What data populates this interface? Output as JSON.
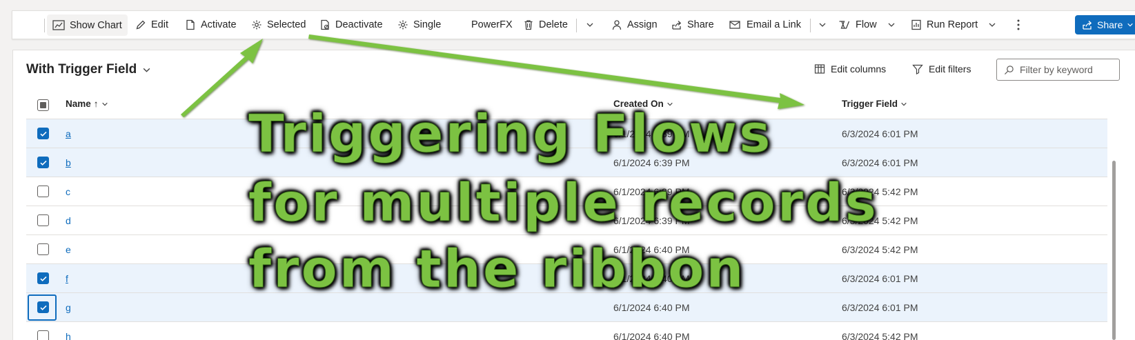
{
  "command_bar": {
    "show_chart": "Show Chart",
    "edit": "Edit",
    "activate": "Activate",
    "selected": "Selected",
    "deactivate": "Deactivate",
    "single": "Single",
    "powerfx": "PowerFX",
    "delete": "Delete",
    "assign": "Assign",
    "share": "Share",
    "email_link": "Email a Link",
    "flow": "Flow",
    "run_report": "Run Report",
    "share_button": "Share"
  },
  "view": {
    "title": "With Trigger Field",
    "edit_columns": "Edit columns",
    "edit_filters": "Edit filters",
    "filter_placeholder": "Filter by keyword"
  },
  "columns": {
    "name": "Name",
    "name_sort": "↑",
    "created_on": "Created On",
    "trigger_field": "Trigger Field"
  },
  "rows": [
    {
      "name": "a",
      "created": "6/1/2024 6:39 PM",
      "trigger": "6/3/2024 6:01 PM",
      "selected": true
    },
    {
      "name": "b",
      "created": "6/1/2024 6:39 PM",
      "trigger": "6/3/2024 6:01 PM",
      "selected": true
    },
    {
      "name": "c",
      "created": "6/1/2024 6:39 PM",
      "trigger": "6/3/2024 5:42 PM",
      "selected": false
    },
    {
      "name": "d",
      "created": "6/1/2024 6:39 PM",
      "trigger": "6/3/2024 5:42 PM",
      "selected": false
    },
    {
      "name": "e",
      "created": "6/1/2024 6:40 PM",
      "trigger": "6/3/2024 5:42 PM",
      "selected": false
    },
    {
      "name": "f",
      "created": "6/1/2024 6:40 PM",
      "trigger": "6/3/2024 6:01 PM",
      "selected": true
    },
    {
      "name": "g",
      "created": "6/1/2024 6:40 PM",
      "trigger": "6/3/2024 6:01 PM",
      "selected": true
    },
    {
      "name": "h",
      "created": "6/1/2024 6:40 PM",
      "trigger": "6/3/2024 5:42 PM",
      "selected": false
    }
  ],
  "overlay": {
    "line1": "Triggering Flows",
    "line2": "for multiple records",
    "line3": "from  the ribbon"
  },
  "colors": {
    "accent": "#0f6cbd",
    "selected_row": "#ebf3fc",
    "annotation_green": "#7cc242"
  },
  "icons": [
    "back-arrow-icon",
    "chart-icon",
    "pencil-icon",
    "document-icon",
    "gear-icon",
    "deactivate-icon",
    "trash-icon",
    "chevron-down-icon",
    "person-icon",
    "share-icon",
    "email-icon",
    "flow-icon",
    "report-icon",
    "more-icon",
    "columns-icon",
    "filter-icon",
    "search-icon",
    "checkmark-icon"
  ]
}
